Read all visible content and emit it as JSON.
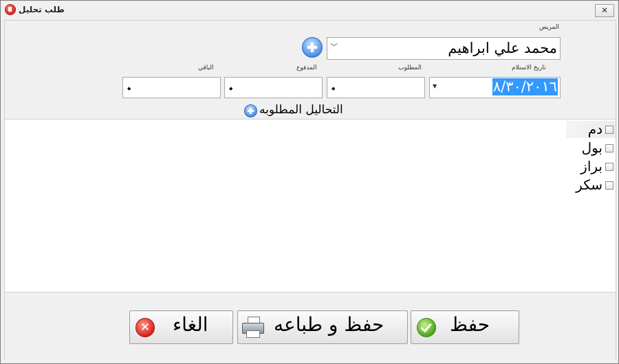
{
  "window": {
    "title": "طلب تحليل",
    "close_symbol": "✕"
  },
  "form": {
    "patient_label": "المريض",
    "patient_value": "محمد علي ابراهيم",
    "date_label": "تاريخ الاستلام",
    "date_value": "٨/٣٠/٢٠١٦",
    "required_label": "المطلوب",
    "paid_label": "المدفوع",
    "remaining_label": "الباقي",
    "required_value": "",
    "paid_value": "",
    "remaining_value": ""
  },
  "tests_section": {
    "title": "التحاليل المطلوبه",
    "items": [
      {
        "label": "دم",
        "checked": false
      },
      {
        "label": "بول",
        "checked": false
      },
      {
        "label": "براز",
        "checked": false
      },
      {
        "label": "سكر",
        "checked": false
      }
    ]
  },
  "buttons": {
    "save": "حفظ",
    "save_print": "حفظ و طباعه",
    "cancel": "الغاء"
  },
  "icons": {
    "app": "app-icon",
    "add_patient": "plus-circle-icon",
    "add_test": "plus-circle-icon",
    "save": "checkmark-icon",
    "save_print": "printer-icon",
    "cancel": "x-circle-icon"
  }
}
